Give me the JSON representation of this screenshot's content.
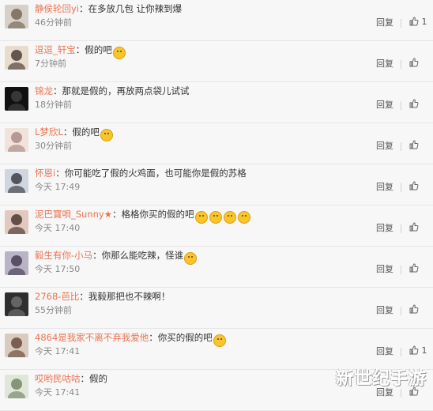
{
  "comments": [
    {
      "username": "静侯轮回yi",
      "text": "：在多放几包 让你辣到爆",
      "time": "46分钟前",
      "reply": "回复",
      "likes": "1",
      "emojis": []
    },
    {
      "username": "逗逗_轩宝",
      "text": "：假的吧",
      "time": "7分钟前",
      "reply": "回复",
      "likes": "",
      "emojis": [
        "laugh-emoji"
      ]
    },
    {
      "username": "锦龙",
      "text": "：那就是假的，再放两点袋儿试试",
      "time": "18分钟前",
      "reply": "回复",
      "likes": "",
      "emojis": []
    },
    {
      "username": "L梦欣L",
      "text": "：假的吧",
      "time": "30分钟前",
      "reply": "回复",
      "likes": "",
      "emojis": [
        "laugh-emoji"
      ]
    },
    {
      "username": "怀恩i",
      "text": "：你可能吃了假的火鸡面，也可能你是假的苏格",
      "time": "今天 17:49",
      "reply": "回复",
      "likes": "",
      "emojis": []
    },
    {
      "username": "泥巴寶唄_Sunny★",
      "text": "：格格你买的假的吧",
      "time": "今天 17:40",
      "reply": "回复",
      "likes": "",
      "emojis": [
        "tongue-emoji",
        "tongue-emoji",
        "tongue-emoji",
        "tongue-emoji"
      ]
    },
    {
      "username": "毅生有你-小马",
      "text": "：你那么能吃辣，怪谁",
      "time": "今天 17:50",
      "reply": "回复",
      "likes": "",
      "emojis": [
        "smile-emoji"
      ]
    },
    {
      "username": "2768-芭比",
      "text": "：我毅那把也不辣啊！",
      "time": "55分钟前",
      "reply": "回复",
      "likes": "",
      "emojis": []
    },
    {
      "username": "4864是我家不离不弃我爱他",
      "text": "：你买的假的吧",
      "time": "今天 17:41",
      "reply": "回复",
      "likes": "1",
      "emojis": [
        "kiss-emoji"
      ]
    },
    {
      "username": "哎哟民咕咕",
      "text": "：假的",
      "time": "今天 17:41",
      "reply": "回复",
      "likes": "",
      "emojis": []
    }
  ],
  "watermark": "新世纪手游",
  "colors": {
    "username": "#eb7350",
    "text": "#333333",
    "time": "#888888"
  }
}
